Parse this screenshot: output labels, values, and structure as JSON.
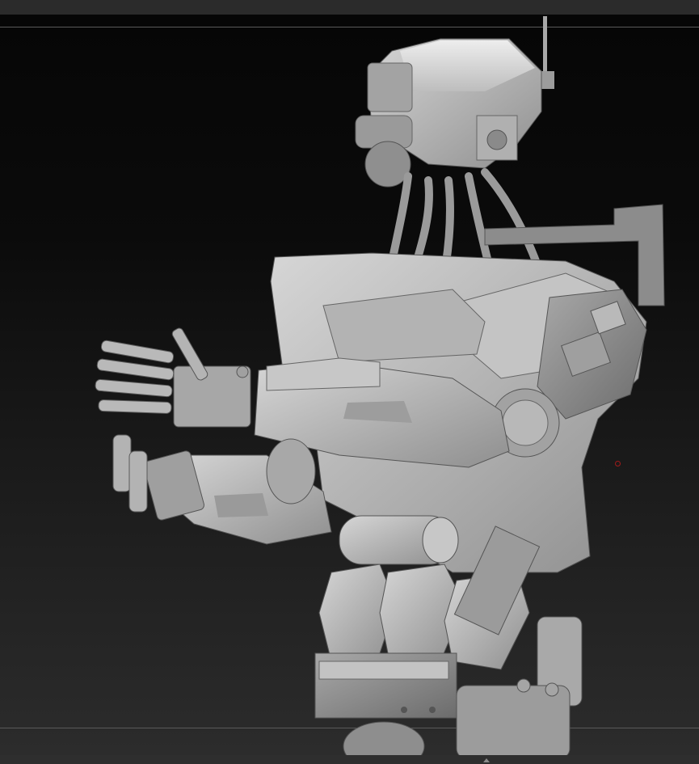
{
  "app": {
    "name": "3d-sculpt-viewport"
  },
  "viewport": {
    "subject": "robot",
    "background_top": "#070707",
    "background_bottom": "#2c2c2c",
    "model_color": "#b4b4b4"
  },
  "pivot": {
    "color": "#a11a1a",
    "icon": "pivot-point-icon"
  },
  "footer": {
    "icon": "triangle-up-icon"
  }
}
